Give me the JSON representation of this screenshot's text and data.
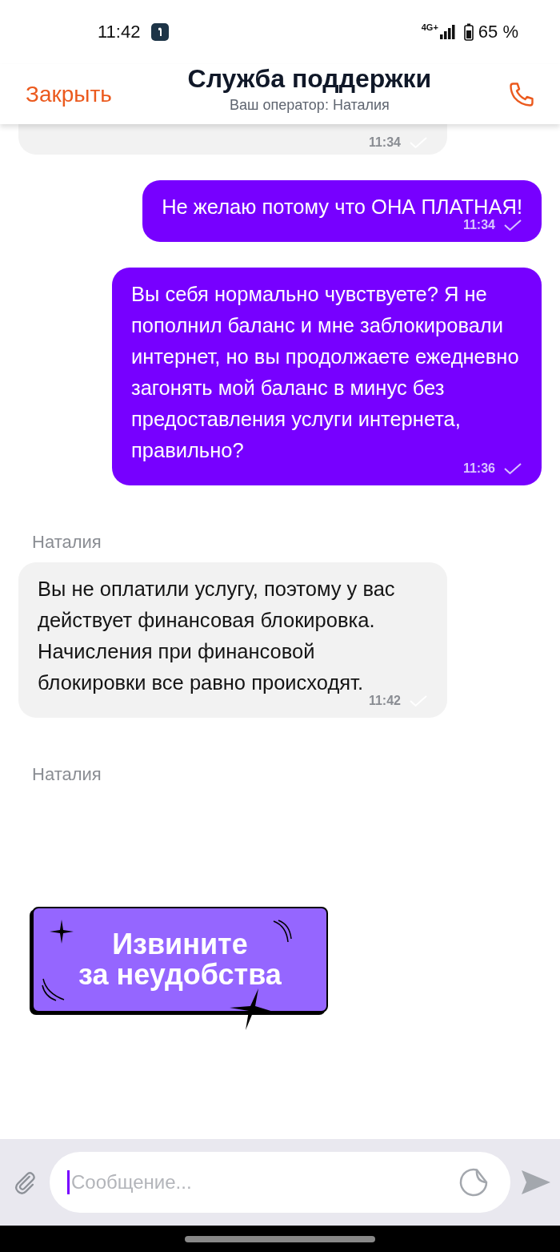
{
  "status_bar": {
    "time": "11:42",
    "network": "4G+",
    "battery": "65 %"
  },
  "header": {
    "close": "Закрыть",
    "title": "Служба поддержки",
    "subtitle": "Ваш оператор: Наталия"
  },
  "messages": [
    {
      "kind": "incoming",
      "time": "11:34",
      "read": false
    },
    {
      "kind": "outgoing",
      "text": "Не желаю потому что ОНА ПЛАТНАЯ!",
      "time": "11:34",
      "read": true
    },
    {
      "kind": "outgoing",
      "text": "Вы себя нормально чувствуете? Я не пополнил баланс и мне заблокировали интернет, но вы продолжаете ежедневно загонять мой баланс в минус без предоставления услуги интернета, правильно?",
      "time": "11:36",
      "read": true
    },
    {
      "kind": "incoming",
      "author": "Наталия",
      "text": "Вы не оплатили услугу, поэтому у вас действует финансовая блокировка. Начисления при финансовой блокировки все равно происходят.",
      "time": "11:42",
      "read": false
    },
    {
      "kind": "sticker",
      "author": "Наталия",
      "lines": [
        "Извините",
        "за неудобства"
      ]
    }
  ],
  "composer": {
    "placeholder": "Сообщение..."
  }
}
